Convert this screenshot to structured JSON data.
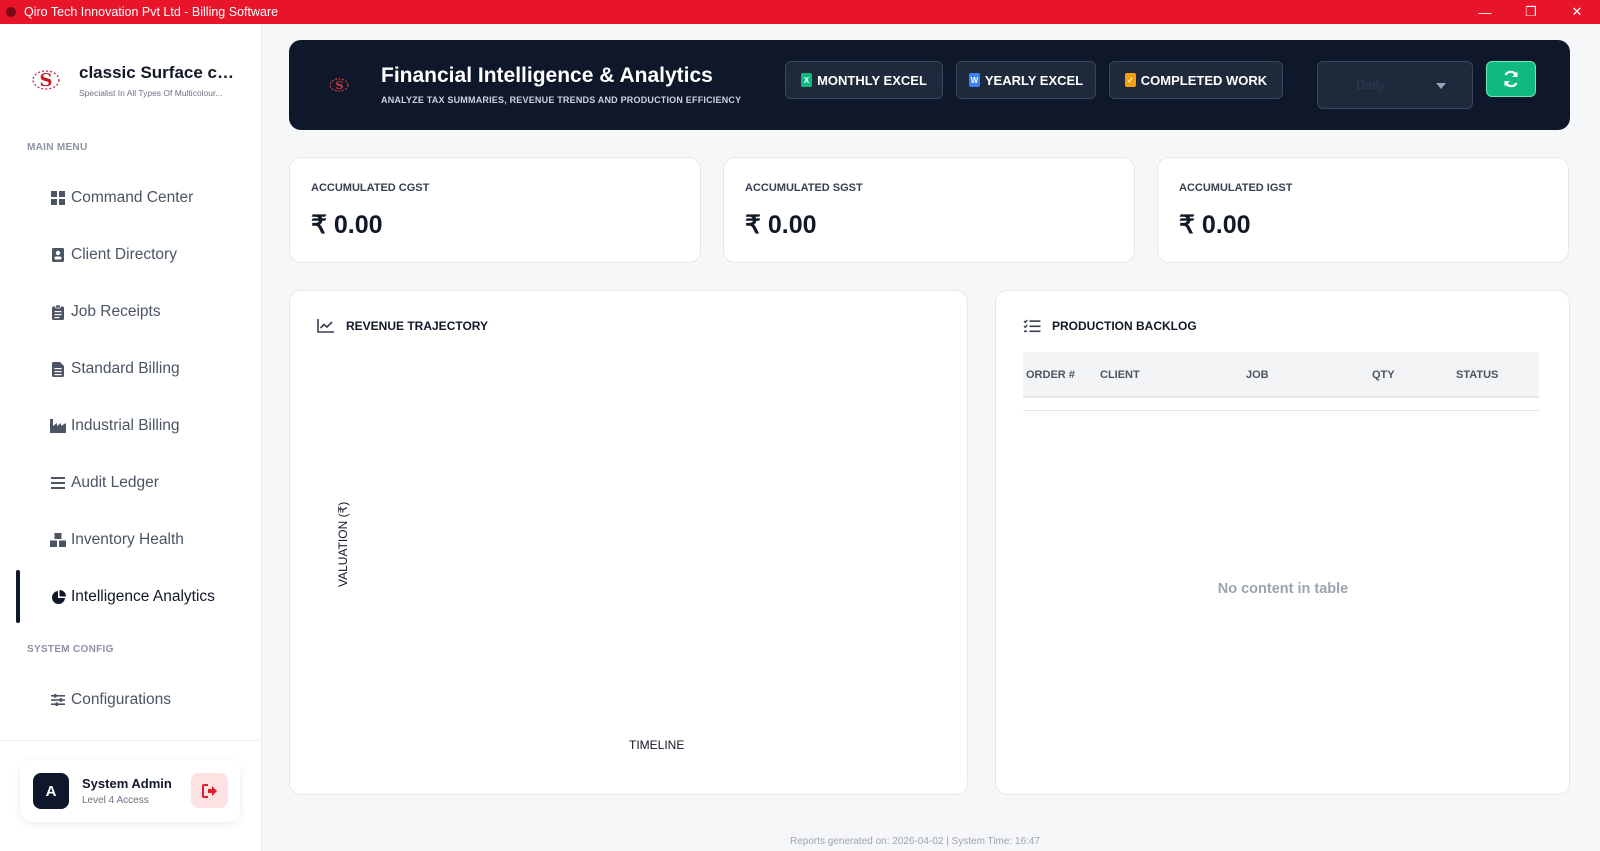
{
  "window": {
    "title": "Qiro Tech Innovation Pvt Ltd - Billing Software",
    "minimize": "—",
    "maximize": "❐",
    "close": "✕"
  },
  "brand": {
    "logo_text": "S",
    "name": "classic Surface co...",
    "tagline": "Specialist In All Types Of Multicolour..."
  },
  "sidebar": {
    "main_menu_label": "MAIN MENU",
    "items": [
      {
        "label": "Command Center",
        "icon": "grid-icon"
      },
      {
        "label": "Client Directory",
        "icon": "contact-card-icon"
      },
      {
        "label": "Job Receipts",
        "icon": "clipboard-icon"
      },
      {
        "label": "Standard Billing",
        "icon": "document-icon"
      },
      {
        "label": "Industrial Billing",
        "icon": "factory-icon"
      },
      {
        "label": "Audit Ledger",
        "icon": "list-icon"
      },
      {
        "label": "Inventory Health",
        "icon": "boxes-icon"
      },
      {
        "label": "Intelligence Analytics",
        "icon": "pie-chart-icon",
        "active": true
      }
    ],
    "system_config_label": "SYSTEM CONFIG",
    "config_item": {
      "label": "Configurations",
      "icon": "sliders-icon"
    }
  },
  "user": {
    "initial": "A",
    "name": "System Admin",
    "level": "Level 4 Access"
  },
  "header": {
    "title": "Financial Intelligence & Analytics",
    "subtitle": "ANALYZE TAX SUMMARIES, REVENUE TRENDS AND PRODUCTION EFFICIENCY",
    "buttons": {
      "monthly": "MONTHLY EXCEL",
      "yearly": "YEARLY EXCEL",
      "completed": "COMPLETED WORK"
    },
    "period_select": "Daily",
    "colors": {
      "banner": "#0f172a",
      "excel_green": "#10b981",
      "doc_blue": "#3b82f6",
      "check_amber": "#f59e0b"
    }
  },
  "stats": [
    {
      "label": "ACCUMULATED CGST",
      "value": "₹ 0.00"
    },
    {
      "label": "ACCUMULATED SGST",
      "value": "₹ 0.00"
    },
    {
      "label": "ACCUMULATED IGST",
      "value": "₹ 0.00"
    }
  ],
  "revenue": {
    "title": "REVENUE TRAJECTORY",
    "y_label": "VALUATION (₹)",
    "x_label": "TIMELINE"
  },
  "backlog": {
    "title": "PRODUCTION BACKLOG",
    "columns": [
      "ORDER #",
      "CLIENT",
      "JOB",
      "QTY",
      "STATUS"
    ],
    "rows": [],
    "empty_message": "No content in table"
  },
  "footer": {
    "text": "Reports generated on: 2026-04-02 | System Time: 16:47"
  }
}
